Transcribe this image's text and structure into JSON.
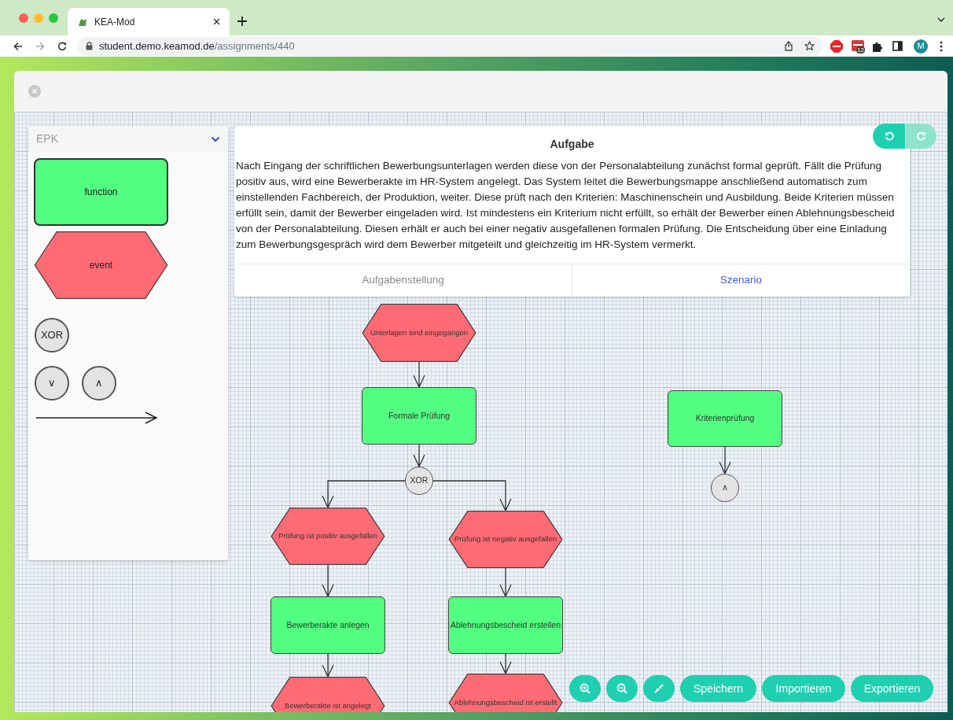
{
  "browser": {
    "tabs": [
      {
        "title": "KEA-Mod",
        "selected": true
      }
    ],
    "url_host": "student.demo.keamod.de",
    "url_path": "/assignments/440",
    "extension_badge": "12",
    "profile_initial": "M"
  },
  "palette": {
    "title": "EPK",
    "items": [
      {
        "kind": "function",
        "label": "function"
      },
      {
        "kind": "event",
        "label": "event"
      },
      {
        "kind": "xor",
        "label": "XOR"
      },
      {
        "kind": "or",
        "label": "∨"
      },
      {
        "kind": "and",
        "label": "∧"
      },
      {
        "kind": "arrow"
      }
    ]
  },
  "task": {
    "title": "Aufgabe",
    "text": "Nach Eingang der schriftlichen Bewerbungsunterlagen werden diese von der Personalabteilung zunächst formal geprüft. Fällt die Prüfung positiv aus, wird eine Bewerberakte im HR-System angelegt. Das System leitet die Bewerbungsmappe anschließend automatisch zum einstellenden Fachbereich, der Produktion, weiter. Diese prüft nach den Kriterien: Maschinenschein und Ausbildung. Beide Kriterien müssen erfüllt sein, damit der Bewerber eingeladen wird. Ist mindestens ein Kriterium nicht erfüllt, so erhält der Bewerber einen Ablehnungsbescheid von der Personalabteilung. Diesen erhält er auch bei einer negativ ausgefallenen formalen Prüfung. Die Entscheidung über eine Einladung zum Bewerbungsgespräch wird dem Bewerber mitgeteilt und gleichzeitig im HR-System vermerkt.",
    "tabs": [
      {
        "label": "Aufgabenstellung",
        "selected": false
      },
      {
        "label": "Szenario",
        "selected": true
      }
    ]
  },
  "history": {
    "undo": {
      "disabled": false
    },
    "redo": {
      "disabled": true
    }
  },
  "diagram": {
    "nodes": [
      {
        "kind": "event",
        "label": "Unterlagen sind eingegangen"
      },
      {
        "kind": "function",
        "label": "Formale Prüfung"
      },
      {
        "kind": "xor",
        "label": "XOR"
      },
      {
        "kind": "event",
        "label": "Prüfung ist positiv ausgefallen"
      },
      {
        "kind": "event",
        "label": "Prüfung ist negativ ausgefallen"
      },
      {
        "kind": "function",
        "label": "Bewerberakte anlegen"
      },
      {
        "kind": "function",
        "label": "Ablehnungsbescheid erstellen"
      },
      {
        "kind": "event",
        "label": "Bewerberakte ist angelegt"
      },
      {
        "kind": "event",
        "label": "Ablehnungsbescheid ist erstellt"
      },
      {
        "kind": "function",
        "label": "Kriterienprüfung"
      },
      {
        "kind": "and",
        "label": "∧"
      }
    ]
  },
  "toolbar": {
    "icon_buttons": [
      {
        "kind": "zoom_in"
      },
      {
        "kind": "zoom_out"
      },
      {
        "kind": "fit"
      }
    ],
    "buttons": [
      "Speichern",
      "Importieren",
      "Exportieren"
    ]
  }
}
